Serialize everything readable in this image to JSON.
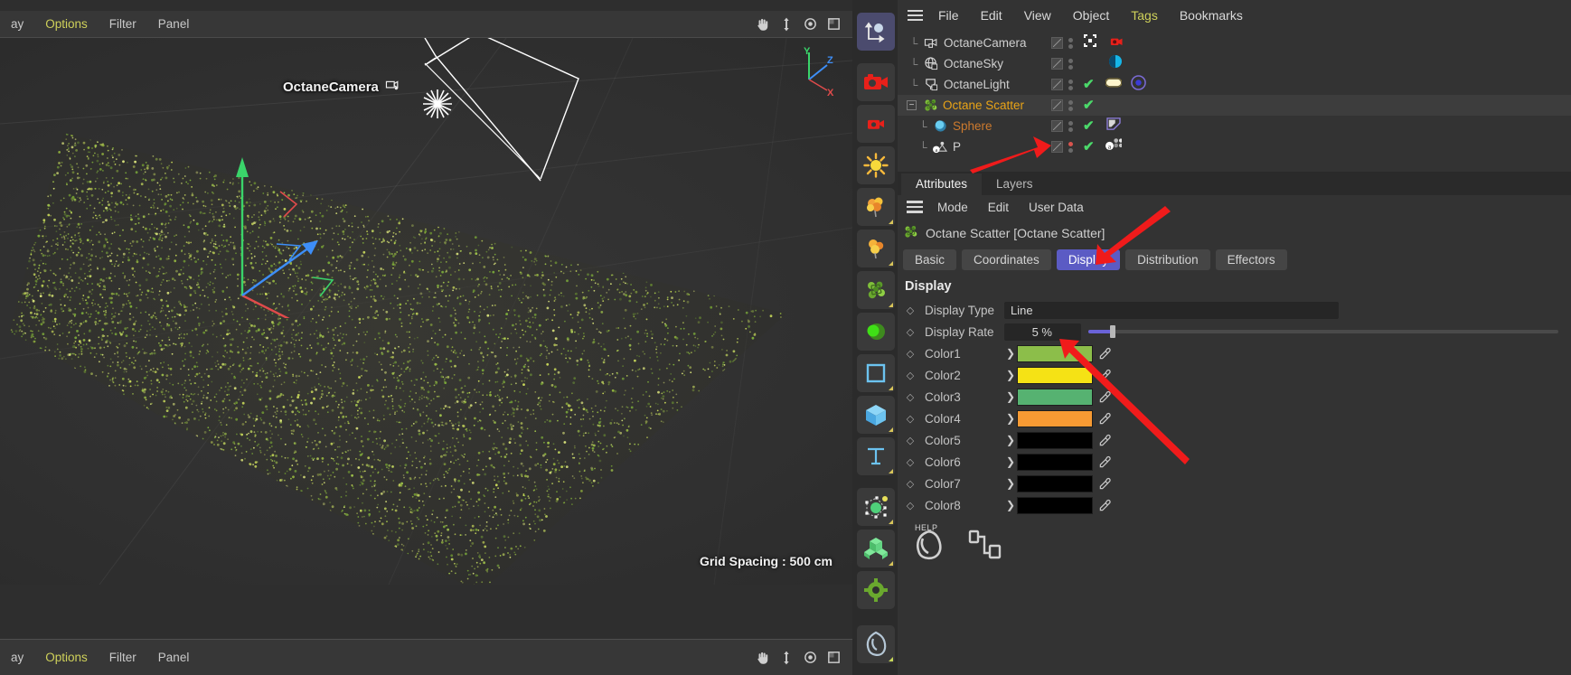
{
  "app": {
    "viewport": {
      "menu_items": [
        {
          "label": "ay",
          "highlight": false
        },
        {
          "label": "Options",
          "highlight": true
        },
        {
          "label": "Filter",
          "highlight": false
        },
        {
          "label": "Panel",
          "highlight": false
        }
      ],
      "tool_icons": [
        "hand-icon",
        "move-vertical-icon",
        "rotate-icon",
        "frame-icon"
      ],
      "camera_label": "OctaneCamera",
      "grid_spacing": "Grid Spacing : 500 cm",
      "axis_labels": {
        "y": "Y",
        "z": "Z",
        "x": "X"
      },
      "axis_colors": {
        "y": "#3ad46a",
        "z": "#3d8ef7",
        "x": "#e04b4b"
      },
      "bottom_menu_items": [
        {
          "label": "ay",
          "highlight": false
        },
        {
          "label": "Options",
          "highlight": true
        },
        {
          "label": "Filter",
          "highlight": false
        },
        {
          "label": "Panel",
          "highlight": false
        }
      ]
    },
    "main_menu": [
      {
        "label": "File"
      },
      {
        "label": "Edit"
      },
      {
        "label": "View"
      },
      {
        "label": "Object"
      },
      {
        "label": "Tags"
      },
      {
        "label": "Bookmarks"
      }
    ],
    "object_manager": {
      "rows": [
        {
          "name": "OctaneCamera",
          "icon": "octane-camera-icon",
          "selected": false,
          "child": false,
          "expandable": false,
          "has_tick": false,
          "tags": [
            "render-camera-tag"
          ]
        },
        {
          "name": "OctaneSky",
          "icon": "octane-sky-icon",
          "selected": false,
          "child": false,
          "expandable": false,
          "has_tick": false,
          "tags": [
            "sky-tag"
          ]
        },
        {
          "name": "OctaneLight",
          "icon": "octane-light-icon",
          "selected": false,
          "child": false,
          "expandable": false,
          "has_tick": true,
          "tags": [
            "light-tag",
            "target-tag"
          ]
        },
        {
          "name": "Octane Scatter",
          "icon": "octane-scatter-icon",
          "selected": true,
          "child": false,
          "expandable": true,
          "has_tick": true,
          "tags": []
        },
        {
          "name": "Sphere",
          "icon": "sphere-icon",
          "selected": false,
          "child": true,
          "expandable": false,
          "has_tick": true,
          "tags": [
            "phong-tag"
          ]
        },
        {
          "name": "P",
          "icon": "point-light-icon",
          "selected": false,
          "child": true,
          "expandable": false,
          "has_tick": true,
          "tags": [
            "annotation-tag"
          ]
        }
      ]
    },
    "attributes": {
      "tabs": [
        {
          "label": "Attributes",
          "active": true
        },
        {
          "label": "Layers",
          "active": false
        }
      ],
      "menu": [
        {
          "label": "Mode"
        },
        {
          "label": "Edit"
        },
        {
          "label": "User Data"
        }
      ],
      "object_title": "Octane Scatter [Octane Scatter]",
      "subtabs": [
        {
          "label": "Basic",
          "active": false
        },
        {
          "label": "Coordinates",
          "active": false
        },
        {
          "label": "Display",
          "active": true
        },
        {
          "label": "Distribution",
          "active": false
        },
        {
          "label": "Effectors",
          "active": false
        }
      ],
      "section_title": "Display",
      "properties": [
        {
          "label": "Display Type",
          "value": "Line",
          "kind": "dropdown"
        },
        {
          "label": "Display Rate",
          "value": "5 %",
          "kind": "slider",
          "slider_percent": 5
        }
      ],
      "colors": [
        {
          "label": "Color1",
          "hex": "#8cbe4a"
        },
        {
          "label": "Color2",
          "hex": "#f5e215"
        },
        {
          "label": "Color3",
          "hex": "#56b271"
        },
        {
          "label": "Color4",
          "hex": "#f79a33"
        },
        {
          "label": "Color5",
          "hex": "#000000"
        },
        {
          "label": "Color6",
          "hex": "#000000"
        },
        {
          "label": "Color7",
          "hex": "#000000"
        },
        {
          "label": "Color8",
          "hex": "#000000"
        }
      ],
      "footer": {
        "help_label": "HELP",
        "help_icon": "octane-help-icon",
        "node_icon": "node-editor-icon"
      }
    },
    "icon_palette": [
      {
        "name": "axis-object-icon",
        "selected": true
      },
      {
        "name": "camera-red-icon",
        "selected": false
      },
      {
        "name": "camera-small-icon",
        "selected": false
      },
      {
        "name": "sun-light-icon",
        "selected": false
      },
      {
        "name": "tree-scatter-orange-icon",
        "selected": false
      },
      {
        "name": "tree-scatter-orange2-icon",
        "selected": false
      },
      {
        "name": "scatter-green-icon",
        "selected": false
      },
      {
        "name": "sphere-green-icon",
        "selected": false
      },
      {
        "name": "square-primitive-icon",
        "selected": false
      },
      {
        "name": "cube-primitive-icon",
        "selected": false
      },
      {
        "name": "text-primitive-icon",
        "selected": false
      },
      {
        "name": "deformer-icon",
        "selected": false
      },
      {
        "name": "cloner-green-icon",
        "selected": false
      },
      {
        "name": "gear-settings-icon",
        "selected": false
      },
      {
        "name": "octane-logo-icon",
        "selected": false
      }
    ],
    "accent_colors": {
      "selection_blue": "#5b5bc4",
      "arrow_red": "#f01b1b",
      "tick_green": "#4bd96a",
      "selected_object": "#e8a317"
    }
  }
}
